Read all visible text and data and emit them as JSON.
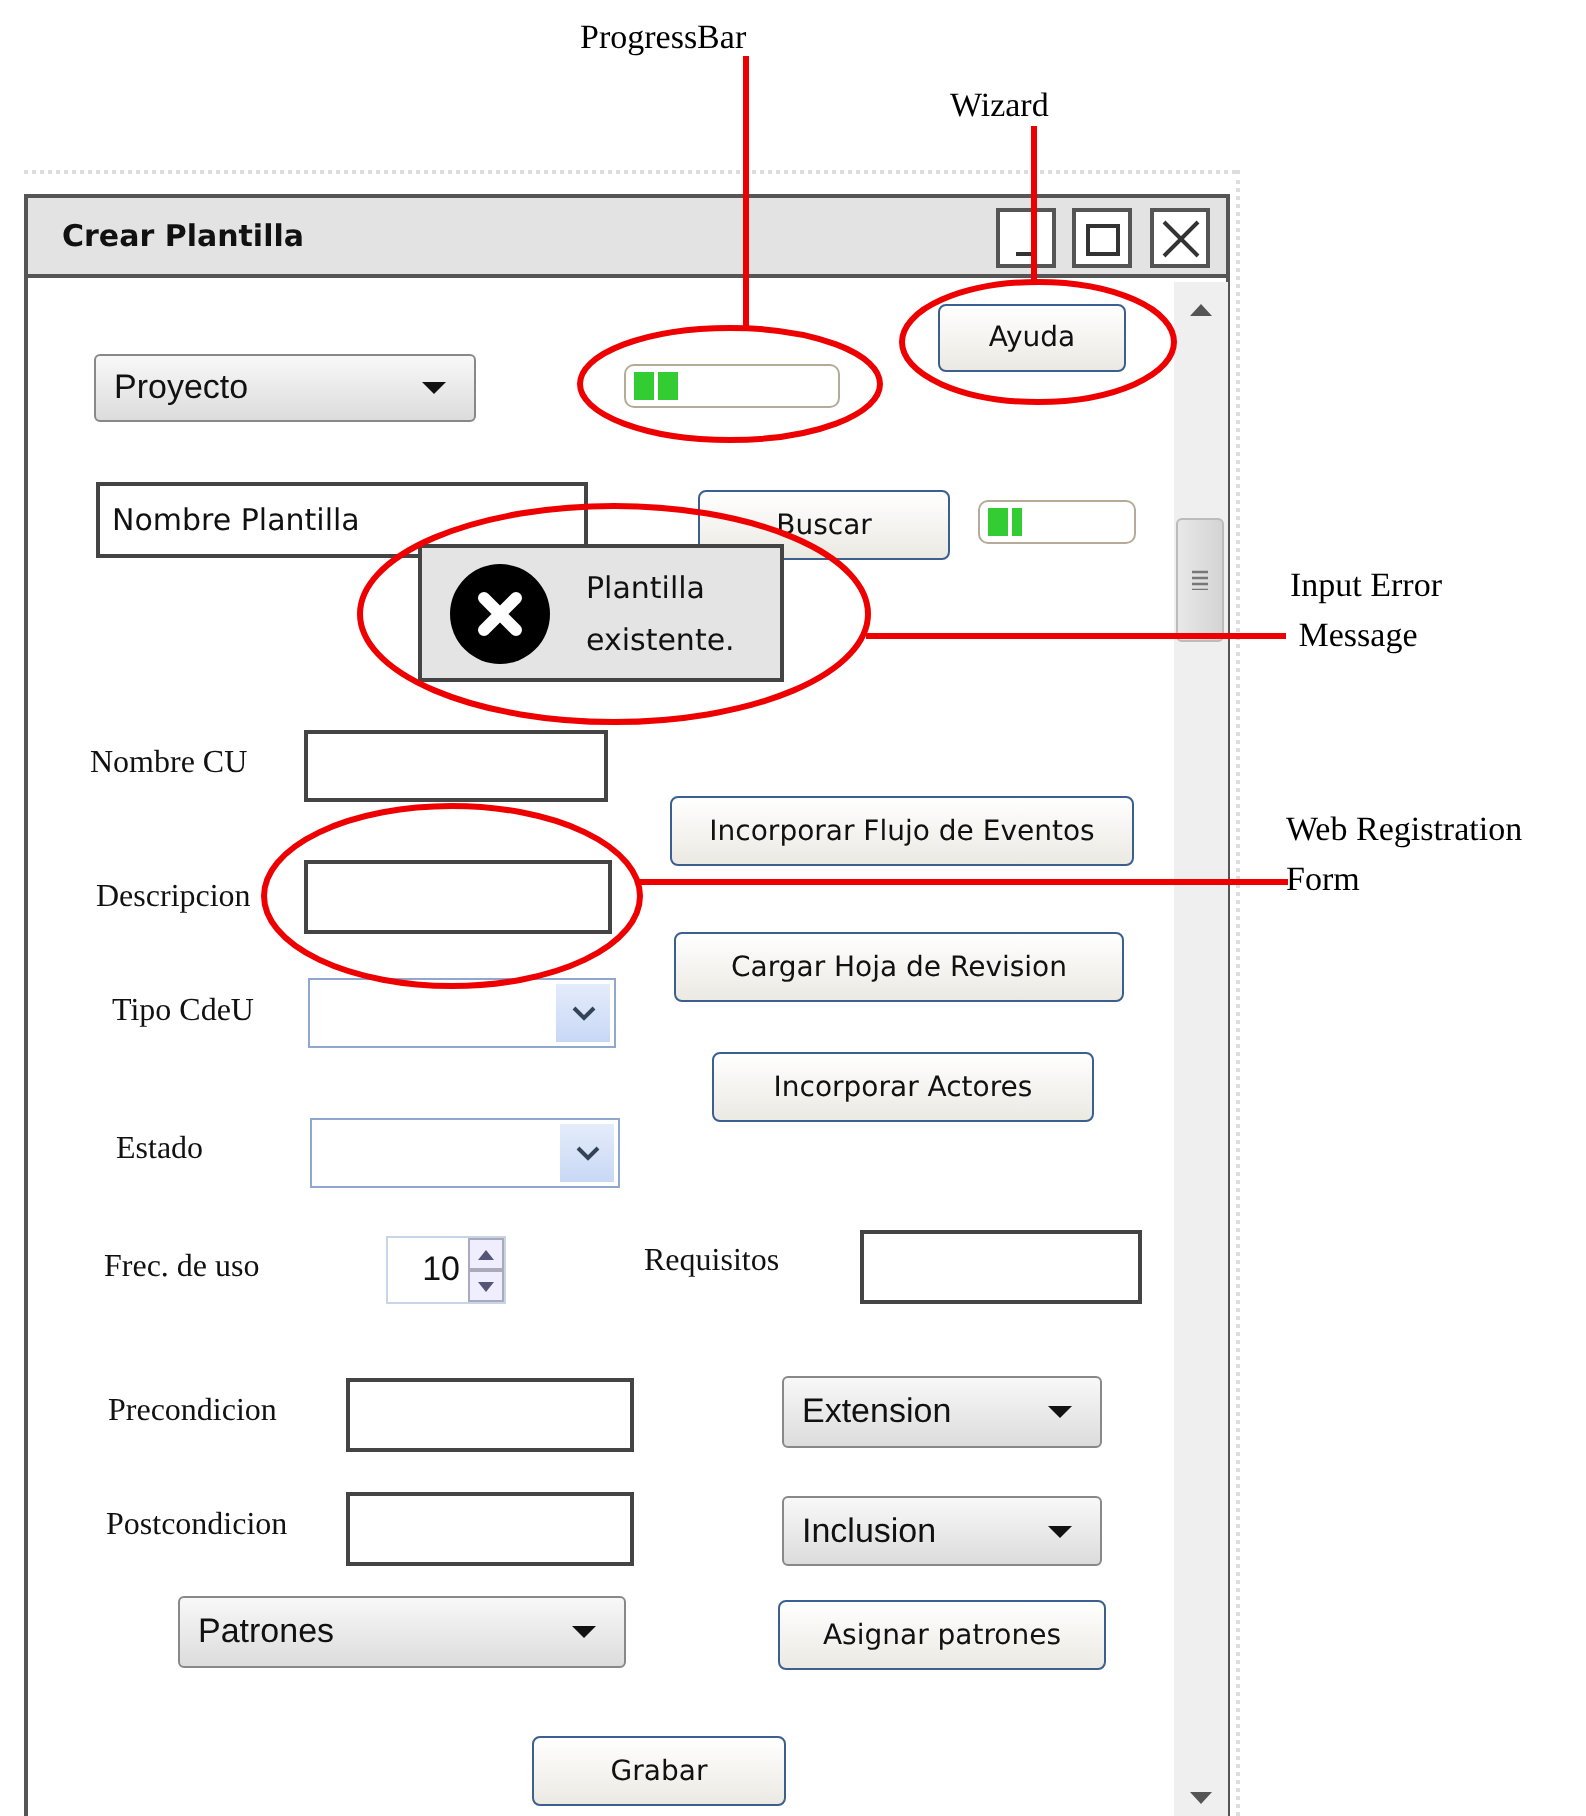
{
  "annotations": [
    {
      "text": "ProgressBar"
    },
    {
      "text": "Wizard"
    },
    {
      "text": "Input Error\n Message"
    },
    {
      "text": "Web Registration\nForm"
    }
  ],
  "window": {
    "title": "Crear Plantilla"
  },
  "controls": [
    {
      "kind": "dropdown",
      "label": "Proyecto"
    },
    {
      "kind": "progress",
      "level": 0.22
    },
    {
      "kind": "button",
      "label": "Ayuda"
    },
    {
      "kind": "field",
      "value": "Nombre Plantilla"
    },
    {
      "kind": "button",
      "label": "Buscar"
    },
    {
      "kind": "progress",
      "level": 0.25
    },
    {
      "kind": "error",
      "text": "Plantilla\nexistente."
    },
    {
      "kind": "label",
      "text": "Nombre CU"
    },
    {
      "kind": "field"
    },
    {
      "kind": "button",
      "label": "Incorporar Flujo de Eventos"
    },
    {
      "kind": "label",
      "text": "Descripcion"
    },
    {
      "kind": "field"
    },
    {
      "kind": "button",
      "label": "Cargar Hoja de Revision"
    },
    {
      "kind": "label",
      "text": "Tipo CdeU"
    },
    {
      "kind": "combo"
    },
    {
      "kind": "button",
      "label": "Incorporar Actores"
    },
    {
      "kind": "label",
      "text": "Estado"
    },
    {
      "kind": "combo"
    },
    {
      "kind": "label",
      "text": "Frec. de uso"
    },
    {
      "kind": "spinner",
      "value": "10"
    },
    {
      "kind": "label",
      "text": "Requisitos"
    },
    {
      "kind": "field"
    },
    {
      "kind": "label",
      "text": "Precondicion"
    },
    {
      "kind": "field"
    },
    {
      "kind": "dropdown",
      "label": "Extension"
    },
    {
      "kind": "label",
      "text": "Postcondicion"
    },
    {
      "kind": "field"
    },
    {
      "kind": "dropdown",
      "label": "Inclusion"
    },
    {
      "kind": "dropdown",
      "label": "Patrones"
    },
    {
      "kind": "button",
      "label": "Asignar patrones"
    },
    {
      "kind": "button",
      "label": "Grabar"
    }
  ]
}
